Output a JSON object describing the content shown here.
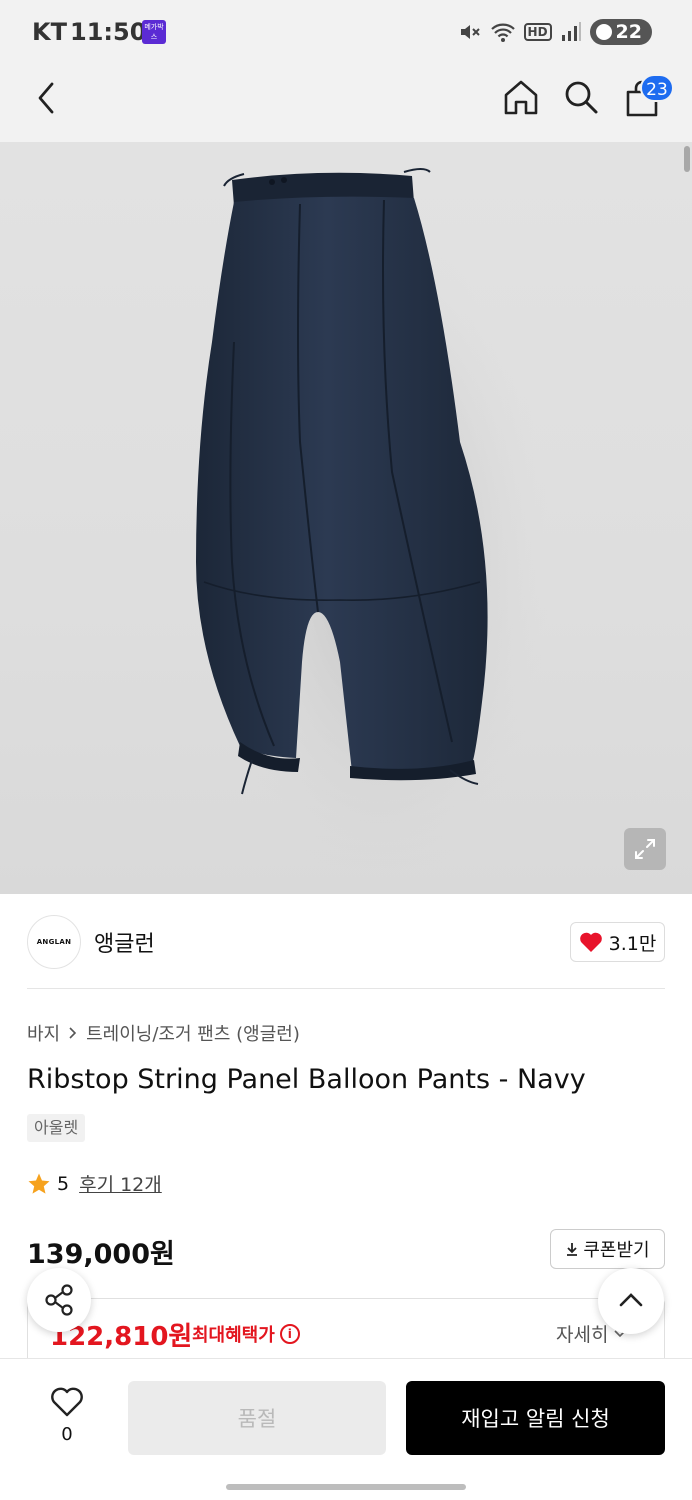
{
  "status_bar": {
    "carrier": "KT",
    "time": "11:50",
    "megabox_text": "메가박스",
    "hd_label": "HD",
    "battery": "22"
  },
  "header": {
    "cart_count": "23"
  },
  "brand": {
    "logo_text": "ANGLAN",
    "name": "앵글런",
    "likes": "3.1만"
  },
  "product": {
    "breadcrumb": [
      "바지",
      "트레이닝/조거 팬츠 (앵글런)"
    ],
    "title": "Ribstop String Panel Balloon Pants - Navy",
    "tag": "아울렛",
    "rating": "5",
    "review_link": "후기 12개",
    "price": "139,000원",
    "coupon_label": "쿠폰받기",
    "benefit_price": "122,810원",
    "benefit_label": "최대혜택가",
    "detail_label": "자세히"
  },
  "bottom": {
    "wish_count": "0",
    "soldout_label": "품절",
    "restock_label": "재입고 알림 신청"
  },
  "colors": {
    "accent_blue": "#1e6cf0",
    "sale_red": "#e3161f",
    "primary_black": "#000000",
    "heart_red": "#e8132b",
    "star_orange": "#f6a21e"
  }
}
